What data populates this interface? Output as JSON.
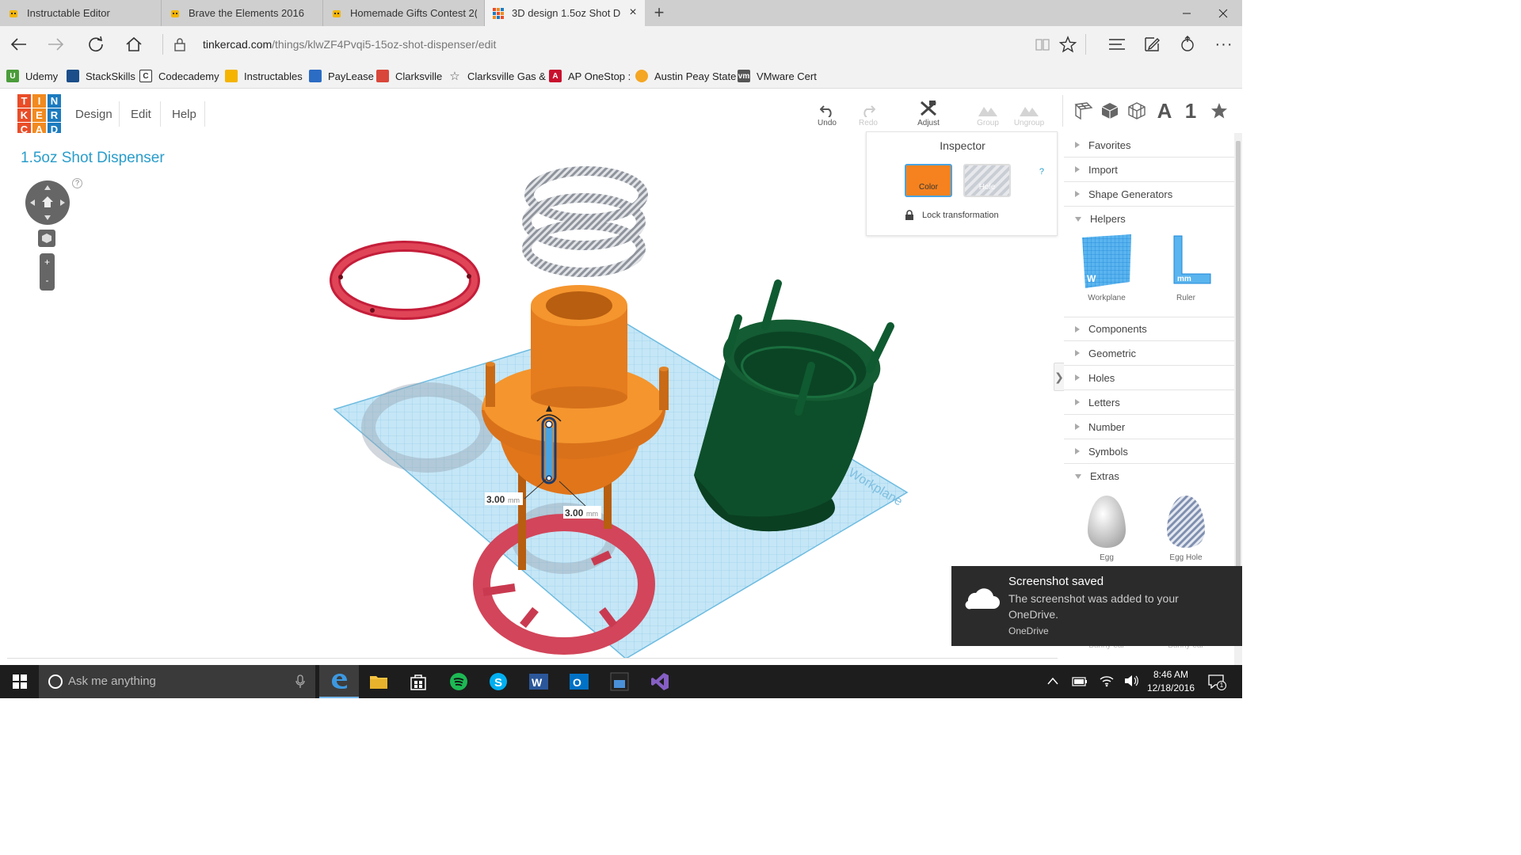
{
  "browser": {
    "tabs": [
      {
        "title": "Instructable Editor"
      },
      {
        "title": "Brave the Elements 2016"
      },
      {
        "title": "Homemade Gifts Contest 2("
      },
      {
        "title": "3D design 1.5oz Shot D"
      }
    ],
    "url_host": "tinkercad.com",
    "url_path": "/things/klwZF4Pvqi5-15oz-shot-dispenser/edit",
    "favorites": [
      "Udemy",
      "StackSkills",
      "Codecademy",
      "Instructables",
      "PayLease",
      "Clarksville",
      "Clarksville Gas &",
      "AP OneStop :",
      "Austin Peay State",
      "VMware Cert"
    ]
  },
  "app": {
    "logo_letters": [
      "T",
      "I",
      "N",
      "K",
      "E",
      "R",
      "C",
      "A",
      "D"
    ],
    "logo_colors": [
      "#e94d28",
      "#f28a1f",
      "#1c7bbf",
      "#e94d28",
      "#f28a1f",
      "#1c7bbf",
      "#e94d28",
      "#f28a1f",
      "#1c7bbf"
    ],
    "menu": [
      "Design",
      "Edit",
      "Help"
    ],
    "toolbar": {
      "undo": "Undo",
      "redo": "Redo",
      "adjust": "Adjust",
      "group": "Group",
      "ungroup": "Ungroup"
    },
    "view_tools": {
      "letters": "A",
      "number": "1"
    },
    "design_title": "1.5oz Shot Dispenser",
    "nav_help": "?",
    "zoom_in": "+",
    "zoom_out": "-",
    "dimensions": [
      "3.00",
      "3.00"
    ],
    "dimension_unit": "mm",
    "workplane_text": "Workplane",
    "inspector": {
      "title": "Inspector",
      "help": "?",
      "color_label": "Color",
      "hole_label": "Hole",
      "selected_color": "#f5821f",
      "lock_label": "Lock transformation"
    },
    "panel_toggle": "❯",
    "panel": {
      "categories": [
        {
          "label": "Favorites"
        },
        {
          "label": "Import"
        },
        {
          "label": "Shape Generators"
        },
        {
          "label": "Helpers"
        },
        {
          "label": "Components"
        },
        {
          "label": "Geometric"
        },
        {
          "label": "Holes"
        },
        {
          "label": "Letters"
        },
        {
          "label": "Number"
        },
        {
          "label": "Symbols"
        },
        {
          "label": "Extras"
        }
      ],
      "helpers": [
        {
          "label": "Workplane",
          "icon": "workplane-icon"
        },
        {
          "label": "Ruler",
          "icon": "ruler-icon"
        }
      ],
      "extras": [
        {
          "label": "Egg",
          "icon": "egg-icon"
        },
        {
          "label": "Egg Hole",
          "icon": "egg-hole-icon"
        }
      ],
      "extras_hidden": [
        "Bunny ear",
        "Bunny ear"
      ]
    }
  },
  "toast": {
    "title": "Screenshot saved",
    "body": "The screenshot was added to your OneDrive.",
    "source": "OneDrive"
  },
  "taskbar": {
    "search_placeholder": "Ask me anything",
    "time": "8:46 AM",
    "date": "12/18/2016",
    "notifications": "1"
  }
}
